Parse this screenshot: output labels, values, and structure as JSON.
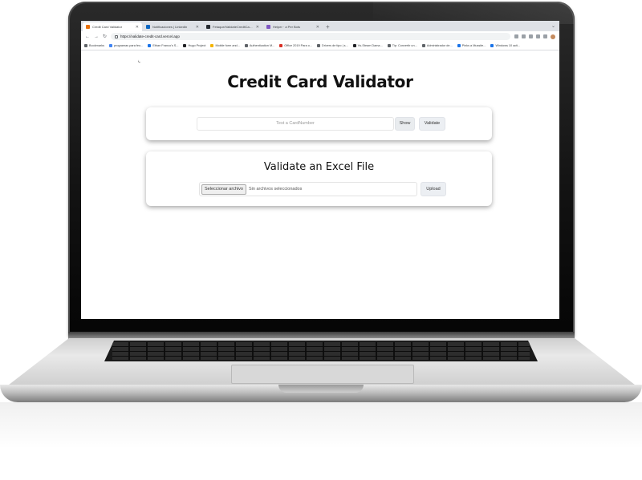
{
  "browser": {
    "tabs": [
      {
        "label": "Credit Card Validator",
        "active": true,
        "favicon_color": "#e8710a"
      },
      {
        "label": "Notificaciones | LinkedIn",
        "active": false,
        "favicon_color": "#0a66c2"
      },
      {
        "label": "Fetaque/ValidateCreditCard: V",
        "active": false,
        "favicon_color": "#24292f"
      },
      {
        "label": "Helper · a Per Bots",
        "active": false,
        "favicon_color": "#7e57c2"
      }
    ],
    "new_tab_symbol": "+",
    "url": "https://validate-credit-card.vercel.app",
    "bookmarks": [
      {
        "label": "Bookmarks",
        "color": "#5f6368"
      },
      {
        "label": "programas para feo...",
        "color": "#4285f4"
      },
      {
        "label": "Ethan Franco's S...",
        "color": "#1a73e8"
      },
      {
        "label": "Hugo Project",
        "color": "#202124"
      },
      {
        "label": "Mobile form and...",
        "color": "#f4b400"
      },
      {
        "label": "Authentication M...",
        "color": "#5f6368"
      },
      {
        "label": "Office 2019 Para o...",
        "color": "#d93025"
      },
      {
        "label": "Drivers de tipo | s...",
        "color": "#5f6368"
      },
      {
        "label": "Vs-Steam Dama...",
        "color": "#202124"
      },
      {
        "label": "Tip: Convertir un...",
        "color": "#5f6368"
      },
      {
        "label": "Administrador de...",
        "color": "#5f6368"
      },
      {
        "label": "Pinks a Mussite...",
        "color": "#1a73e8"
      },
      {
        "label": "Windows 10 acti...",
        "color": "#1a73e8"
      }
    ]
  },
  "page": {
    "title": "Credit Card Validator",
    "card_number_placeholder": "Test a CardNumber",
    "show_button": "Show",
    "validate_button": "Validate",
    "excel_heading": "Validate an Excel File",
    "file_button": "Seleccionar archivo",
    "file_status": "Sin archivos seleccionados",
    "upload_button": "Upload"
  }
}
